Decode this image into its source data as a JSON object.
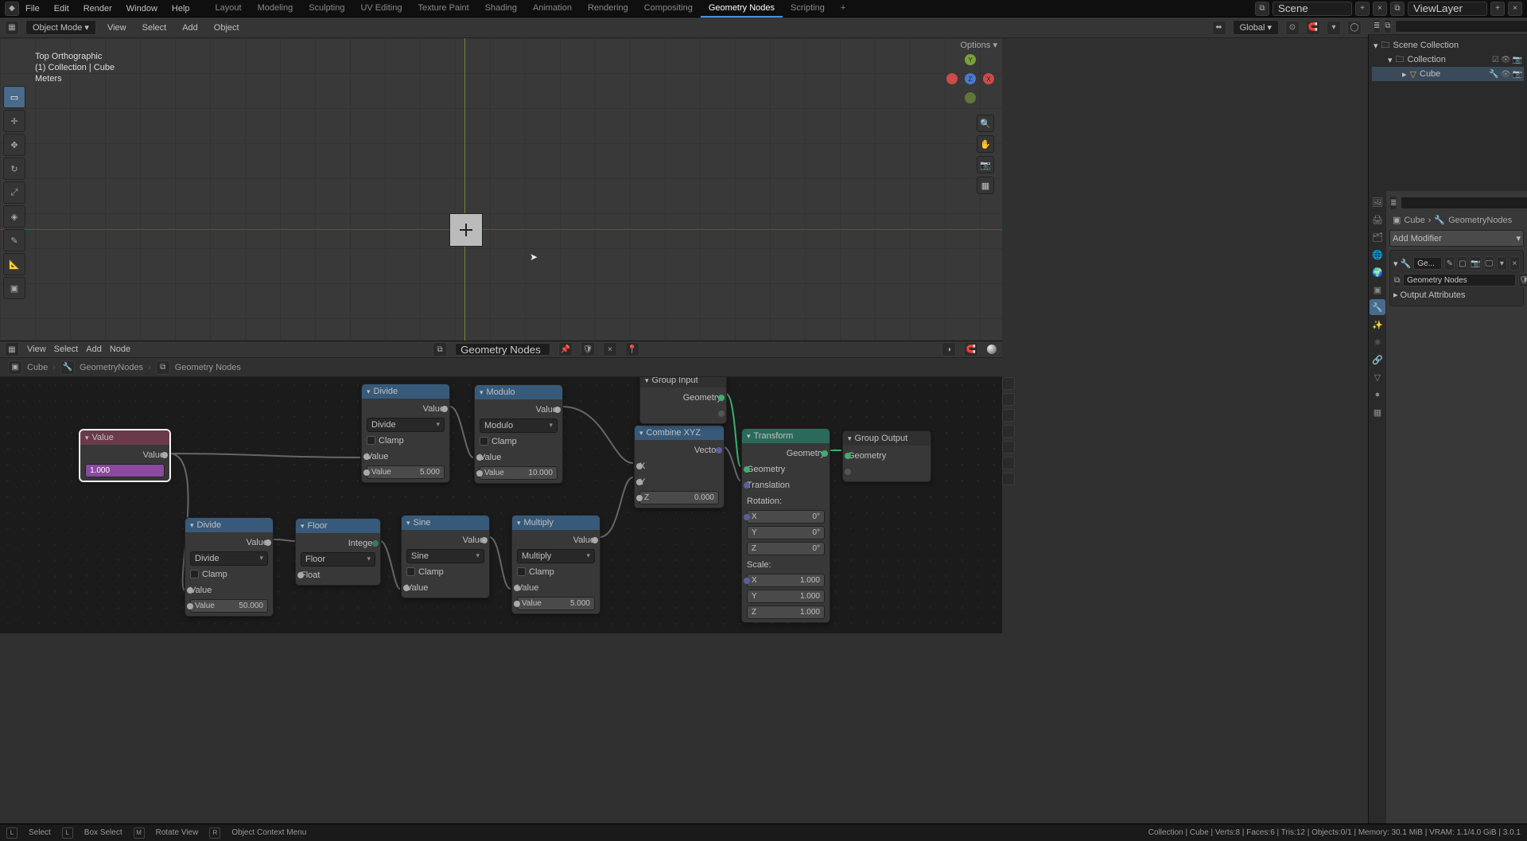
{
  "topbar": {
    "menus": [
      "File",
      "Edit",
      "Render",
      "Window",
      "Help"
    ],
    "workspaces": [
      "Layout",
      "Modeling",
      "Sculpting",
      "UV Editing",
      "Texture Paint",
      "Shading",
      "Animation",
      "Rendering",
      "Compositing",
      "Geometry Nodes",
      "Scripting"
    ],
    "active_workspace": "Geometry Nodes",
    "scene": "Scene",
    "view_layer": "ViewLayer"
  },
  "viewport_header": {
    "mode": "Object Mode",
    "menus": [
      "View",
      "Select",
      "Add",
      "Object"
    ],
    "orientation": "Global",
    "options_label": "Options"
  },
  "overlay": {
    "line1": "Top Orthographic",
    "line2": "(1) Collection | Cube",
    "line3": "Meters"
  },
  "outliner": {
    "root": "Scene Collection",
    "collection": "Collection",
    "object": "Cube"
  },
  "properties": {
    "crumb_obj": "Cube",
    "crumb_mod": "GeometryNodes",
    "add_modifier": "Add Modifier",
    "mod_name_short": "Ge...",
    "node_group": "Geometry Nodes",
    "output_attrs": "Output Attributes"
  },
  "gn_header": {
    "menus": [
      "View",
      "Select",
      "Add",
      "Node"
    ],
    "tree_name": "Geometry Nodes"
  },
  "gn_breadcrumb": {
    "cube": "Cube",
    "mod": "GeometryNodes",
    "tree": "Geometry Nodes"
  },
  "nodes": {
    "value": {
      "title": "Value",
      "out": "Value",
      "val": "1.000"
    },
    "div1": {
      "title": "Divide",
      "out": "Value",
      "op": "Divide",
      "clamp": "Clamp",
      "in": "Value",
      "val_lbl": "Value",
      "val": "5.000"
    },
    "mod": {
      "title": "Modulo",
      "out": "Value",
      "op": "Modulo",
      "clamp": "Clamp",
      "in": "Value",
      "val_lbl": "Value",
      "val": "10.000"
    },
    "div2": {
      "title": "Divide",
      "out": "Value",
      "op": "Divide",
      "clamp": "Clamp",
      "in": "Value",
      "val_lbl": "Value",
      "val": "50.000"
    },
    "floor": {
      "title": "Floor",
      "out": "Integer",
      "op": "Floor",
      "in": "Float"
    },
    "sine": {
      "title": "Sine",
      "out": "Value",
      "op": "Sine",
      "clamp": "Clamp",
      "in": "Value"
    },
    "mult": {
      "title": "Multiply",
      "out": "Value",
      "op": "Multiply",
      "clamp": "Clamp",
      "in": "Value",
      "val_lbl": "Value",
      "val": "5.000"
    },
    "combine": {
      "title": "Combine XYZ",
      "out": "Vector",
      "x": "X",
      "y": "Y",
      "z": "Z",
      "zval": "0.000"
    },
    "gin": {
      "title": "Group Input",
      "out": "Geometry"
    },
    "trans": {
      "title": "Transform",
      "gout": "Geometry",
      "gin": "Geometry",
      "tr": "Translation",
      "rotlbl": "Rotation:",
      "scllbl": "Scale:",
      "x": "X",
      "y": "Y",
      "z": "Z",
      "deg": "0°",
      "s": "1.000"
    },
    "gout": {
      "title": "Group Output",
      "in": "Geometry"
    }
  },
  "statusbar": {
    "select": "Select",
    "box": "Box Select",
    "rotate": "Rotate View",
    "ctx": "Object Context Menu",
    "stats": "Collection | Cube | Verts:8 | Faces:6 | Tris:12 | Objects:0/1 | Memory: 30.1 MiB | VRAM: 1.1/4.0 GiB | 3.0.1"
  }
}
